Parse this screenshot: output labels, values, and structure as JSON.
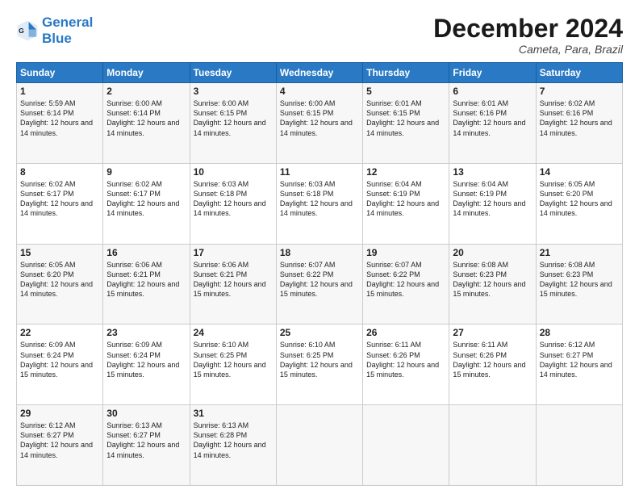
{
  "header": {
    "logo_line1": "General",
    "logo_line2": "Blue",
    "title": "December 2024",
    "location": "Cameta, Para, Brazil"
  },
  "weekdays": [
    "Sunday",
    "Monday",
    "Tuesday",
    "Wednesday",
    "Thursday",
    "Friday",
    "Saturday"
  ],
  "weeks": [
    [
      {
        "day": "1",
        "sunrise": "Sunrise: 5:59 AM",
        "sunset": "Sunset: 6:14 PM",
        "daylight": "Daylight: 12 hours and 14 minutes."
      },
      {
        "day": "2",
        "sunrise": "Sunrise: 6:00 AM",
        "sunset": "Sunset: 6:14 PM",
        "daylight": "Daylight: 12 hours and 14 minutes."
      },
      {
        "day": "3",
        "sunrise": "Sunrise: 6:00 AM",
        "sunset": "Sunset: 6:15 PM",
        "daylight": "Daylight: 12 hours and 14 minutes."
      },
      {
        "day": "4",
        "sunrise": "Sunrise: 6:00 AM",
        "sunset": "Sunset: 6:15 PM",
        "daylight": "Daylight: 12 hours and 14 minutes."
      },
      {
        "day": "5",
        "sunrise": "Sunrise: 6:01 AM",
        "sunset": "Sunset: 6:15 PM",
        "daylight": "Daylight: 12 hours and 14 minutes."
      },
      {
        "day": "6",
        "sunrise": "Sunrise: 6:01 AM",
        "sunset": "Sunset: 6:16 PM",
        "daylight": "Daylight: 12 hours and 14 minutes."
      },
      {
        "day": "7",
        "sunrise": "Sunrise: 6:02 AM",
        "sunset": "Sunset: 6:16 PM",
        "daylight": "Daylight: 12 hours and 14 minutes."
      }
    ],
    [
      {
        "day": "8",
        "sunrise": "Sunrise: 6:02 AM",
        "sunset": "Sunset: 6:17 PM",
        "daylight": "Daylight: 12 hours and 14 minutes."
      },
      {
        "day": "9",
        "sunrise": "Sunrise: 6:02 AM",
        "sunset": "Sunset: 6:17 PM",
        "daylight": "Daylight: 12 hours and 14 minutes."
      },
      {
        "day": "10",
        "sunrise": "Sunrise: 6:03 AM",
        "sunset": "Sunset: 6:18 PM",
        "daylight": "Daylight: 12 hours and 14 minutes."
      },
      {
        "day": "11",
        "sunrise": "Sunrise: 6:03 AM",
        "sunset": "Sunset: 6:18 PM",
        "daylight": "Daylight: 12 hours and 14 minutes."
      },
      {
        "day": "12",
        "sunrise": "Sunrise: 6:04 AM",
        "sunset": "Sunset: 6:19 PM",
        "daylight": "Daylight: 12 hours and 14 minutes."
      },
      {
        "day": "13",
        "sunrise": "Sunrise: 6:04 AM",
        "sunset": "Sunset: 6:19 PM",
        "daylight": "Daylight: 12 hours and 14 minutes."
      },
      {
        "day": "14",
        "sunrise": "Sunrise: 6:05 AM",
        "sunset": "Sunset: 6:20 PM",
        "daylight": "Daylight: 12 hours and 14 minutes."
      }
    ],
    [
      {
        "day": "15",
        "sunrise": "Sunrise: 6:05 AM",
        "sunset": "Sunset: 6:20 PM",
        "daylight": "Daylight: 12 hours and 14 minutes."
      },
      {
        "day": "16",
        "sunrise": "Sunrise: 6:06 AM",
        "sunset": "Sunset: 6:21 PM",
        "daylight": "Daylight: 12 hours and 15 minutes."
      },
      {
        "day": "17",
        "sunrise": "Sunrise: 6:06 AM",
        "sunset": "Sunset: 6:21 PM",
        "daylight": "Daylight: 12 hours and 15 minutes."
      },
      {
        "day": "18",
        "sunrise": "Sunrise: 6:07 AM",
        "sunset": "Sunset: 6:22 PM",
        "daylight": "Daylight: 12 hours and 15 minutes."
      },
      {
        "day": "19",
        "sunrise": "Sunrise: 6:07 AM",
        "sunset": "Sunset: 6:22 PM",
        "daylight": "Daylight: 12 hours and 15 minutes."
      },
      {
        "day": "20",
        "sunrise": "Sunrise: 6:08 AM",
        "sunset": "Sunset: 6:23 PM",
        "daylight": "Daylight: 12 hours and 15 minutes."
      },
      {
        "day": "21",
        "sunrise": "Sunrise: 6:08 AM",
        "sunset": "Sunset: 6:23 PM",
        "daylight": "Daylight: 12 hours and 15 minutes."
      }
    ],
    [
      {
        "day": "22",
        "sunrise": "Sunrise: 6:09 AM",
        "sunset": "Sunset: 6:24 PM",
        "daylight": "Daylight: 12 hours and 15 minutes."
      },
      {
        "day": "23",
        "sunrise": "Sunrise: 6:09 AM",
        "sunset": "Sunset: 6:24 PM",
        "daylight": "Daylight: 12 hours and 15 minutes."
      },
      {
        "day": "24",
        "sunrise": "Sunrise: 6:10 AM",
        "sunset": "Sunset: 6:25 PM",
        "daylight": "Daylight: 12 hours and 15 minutes."
      },
      {
        "day": "25",
        "sunrise": "Sunrise: 6:10 AM",
        "sunset": "Sunset: 6:25 PM",
        "daylight": "Daylight: 12 hours and 15 minutes."
      },
      {
        "day": "26",
        "sunrise": "Sunrise: 6:11 AM",
        "sunset": "Sunset: 6:26 PM",
        "daylight": "Daylight: 12 hours and 15 minutes."
      },
      {
        "day": "27",
        "sunrise": "Sunrise: 6:11 AM",
        "sunset": "Sunset: 6:26 PM",
        "daylight": "Daylight: 12 hours and 15 minutes."
      },
      {
        "day": "28",
        "sunrise": "Sunrise: 6:12 AM",
        "sunset": "Sunset: 6:27 PM",
        "daylight": "Daylight: 12 hours and 14 minutes."
      }
    ],
    [
      {
        "day": "29",
        "sunrise": "Sunrise: 6:12 AM",
        "sunset": "Sunset: 6:27 PM",
        "daylight": "Daylight: 12 hours and 14 minutes."
      },
      {
        "day": "30",
        "sunrise": "Sunrise: 6:13 AM",
        "sunset": "Sunset: 6:27 PM",
        "daylight": "Daylight: 12 hours and 14 minutes."
      },
      {
        "day": "31",
        "sunrise": "Sunrise: 6:13 AM",
        "sunset": "Sunset: 6:28 PM",
        "daylight": "Daylight: 12 hours and 14 minutes."
      },
      null,
      null,
      null,
      null
    ]
  ]
}
